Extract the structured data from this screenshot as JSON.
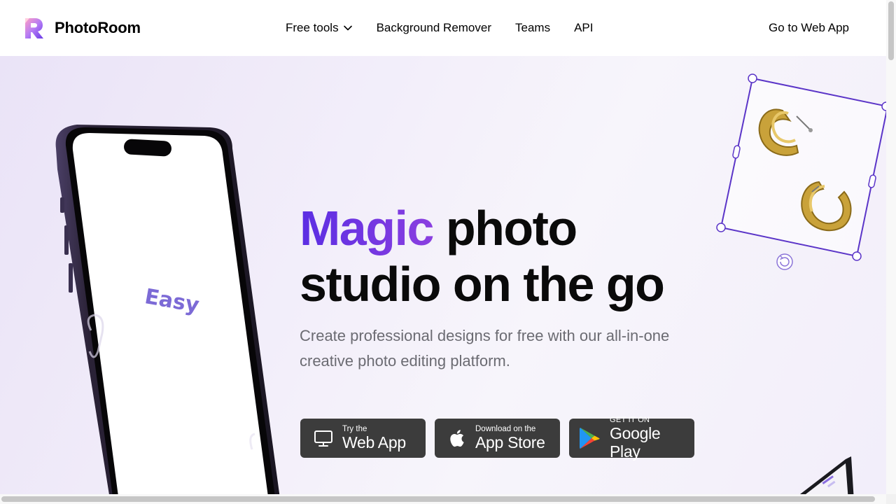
{
  "brand": {
    "name": "PhotoRoom"
  },
  "nav": {
    "items": [
      {
        "label": "Free tools",
        "has_dropdown": true
      },
      {
        "label": "Background Remover"
      },
      {
        "label": "Teams"
      },
      {
        "label": "API"
      }
    ],
    "cta": "Go to Web App"
  },
  "hero": {
    "headline_accent": "Magic",
    "headline_rest_1": " photo",
    "headline_rest_2": "studio on the go",
    "subtitle": "Create professional designs for free with our all-in-one creative photo editing platform.",
    "phone_screen_text": "Easy",
    "colors": {
      "accent_start": "#5b2ee3",
      "accent_end": "#8a3fe0",
      "selection": "#5b35c8",
      "button_bg": "#3c3c3c"
    }
  },
  "buttons": [
    {
      "small": "Try the",
      "big": "Web App",
      "icon": "monitor-icon"
    },
    {
      "small": "Download on the",
      "big": "App Store",
      "icon": "apple-icon"
    },
    {
      "small": "GET IT ON",
      "big": "Google Play",
      "icon": "google-play-icon"
    }
  ]
}
